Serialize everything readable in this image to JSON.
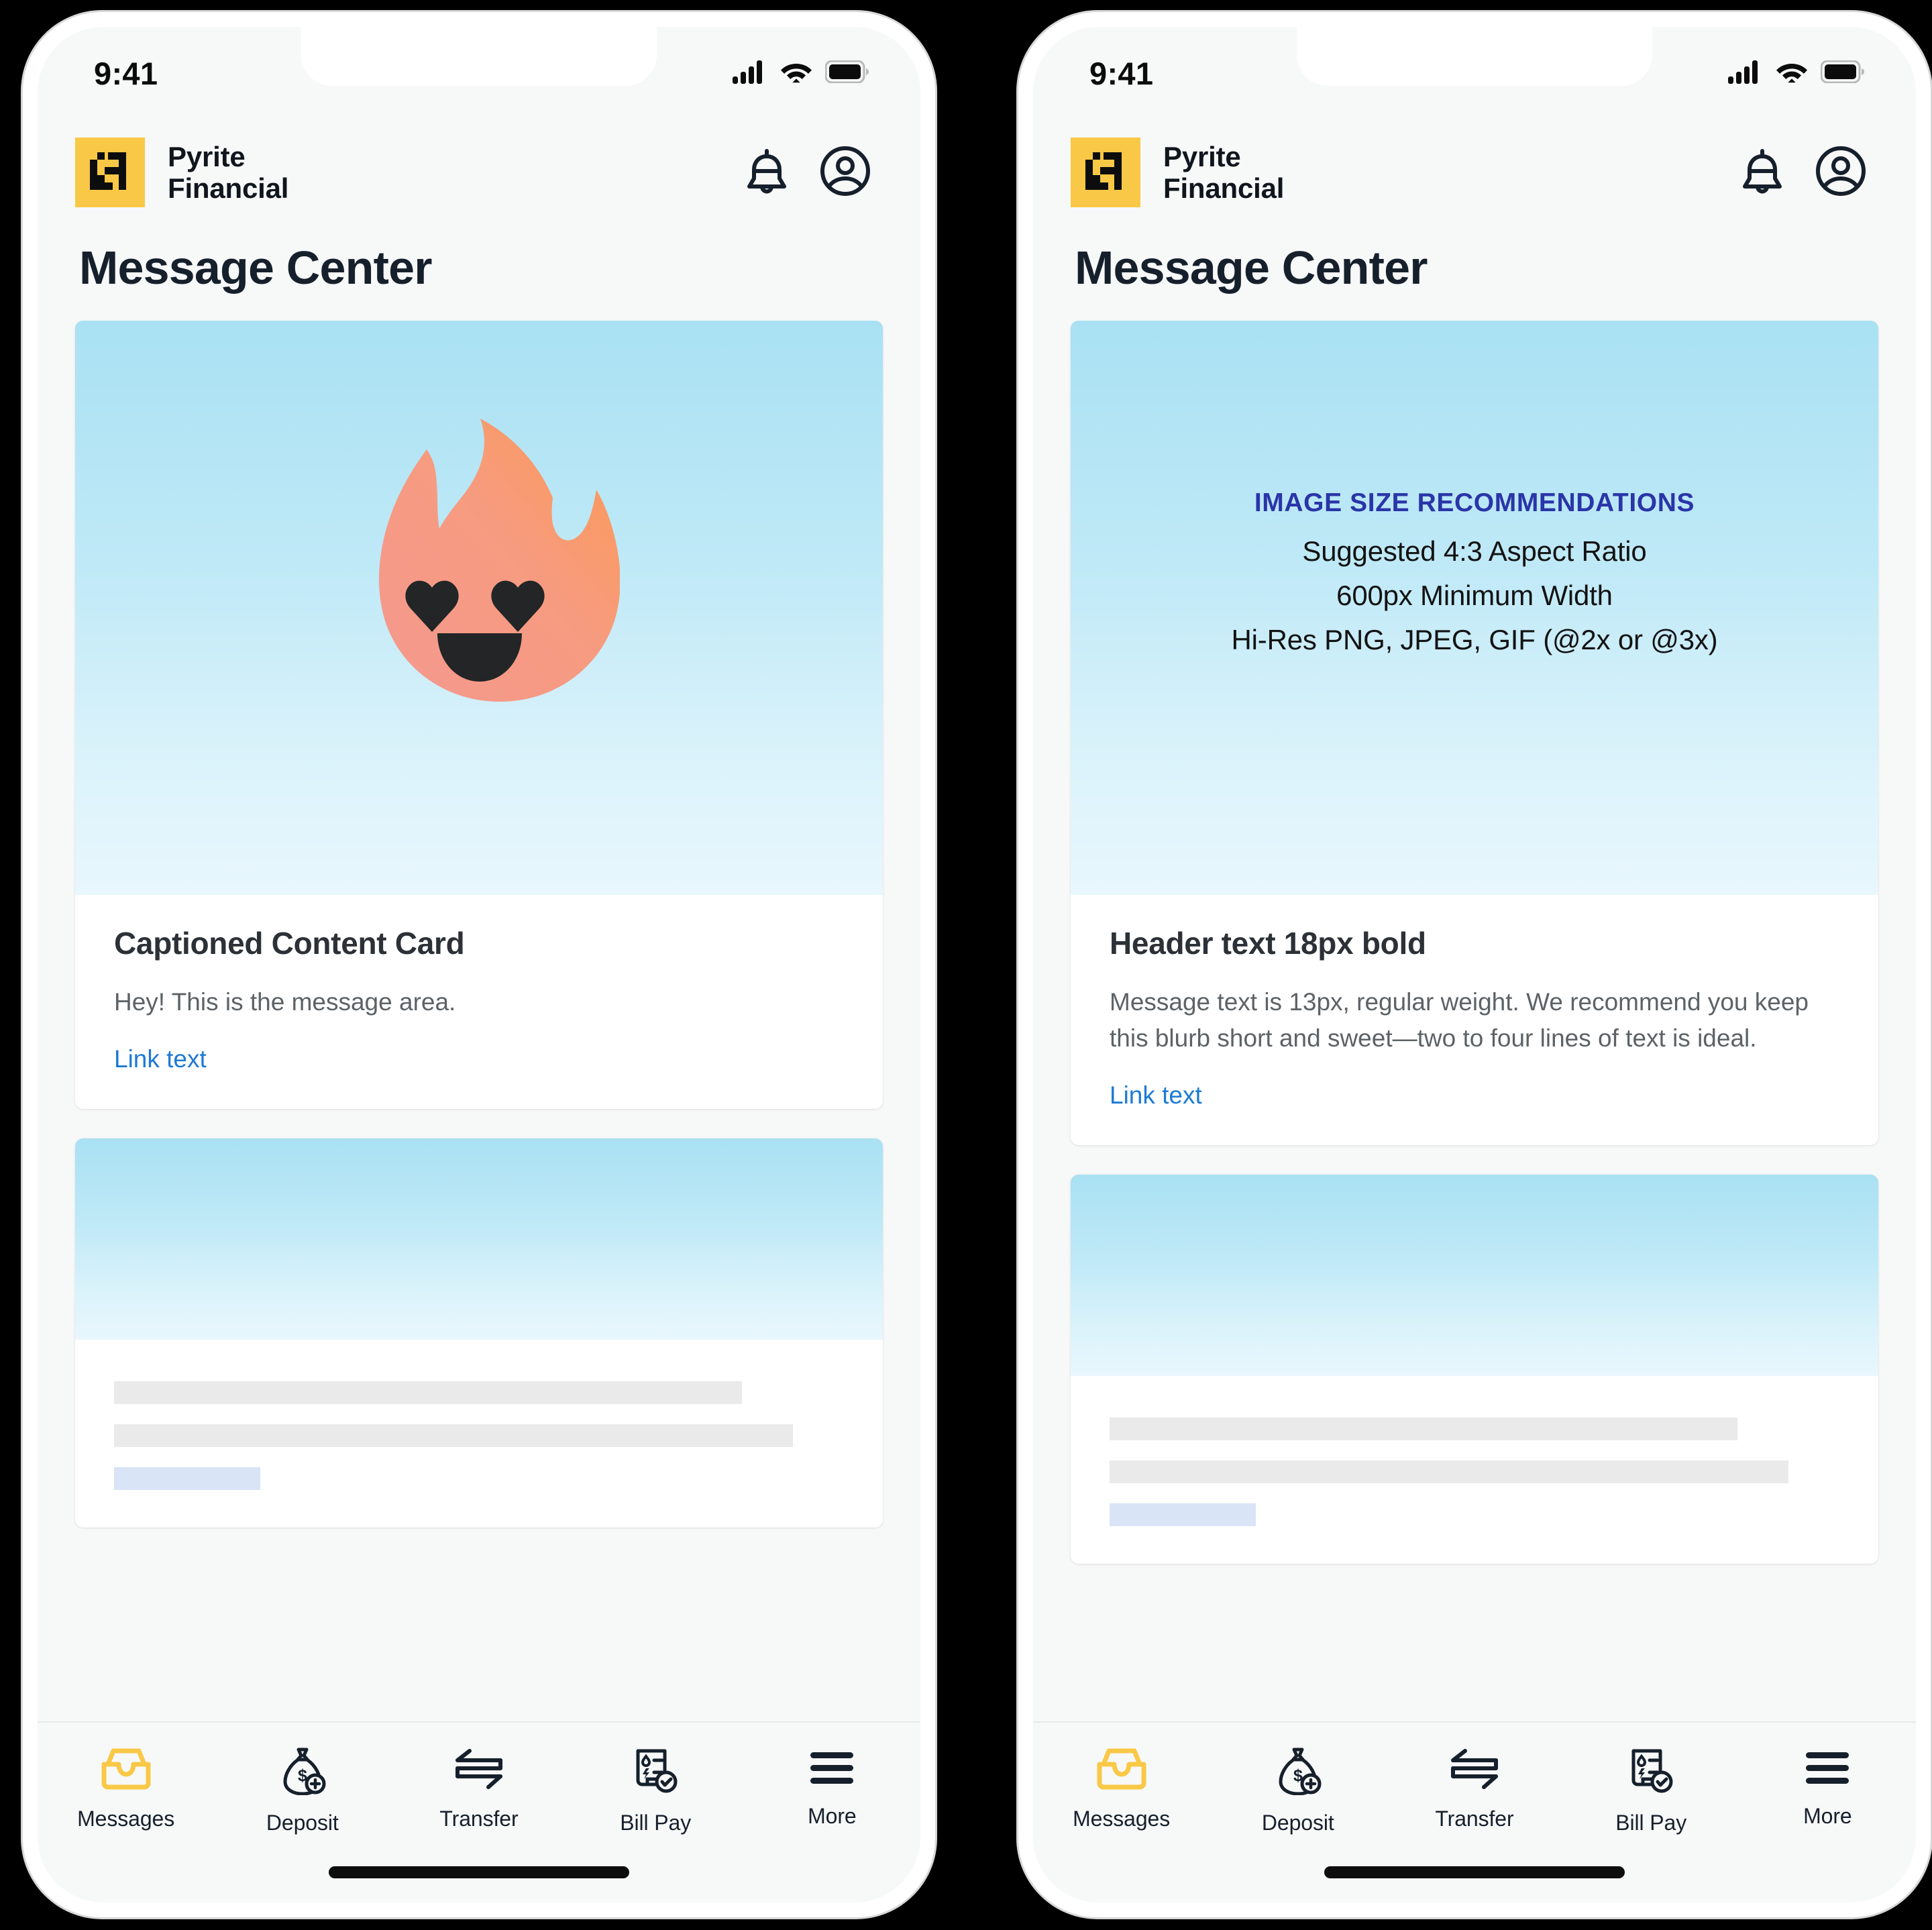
{
  "phones": [
    {
      "id": "left",
      "status": {
        "time": "9:41",
        "signal": "cellular-signal-icon",
        "wifi": "wifi-icon",
        "battery": "battery-full-icon"
      },
      "header": {
        "logo": "pyrite-logo-mark",
        "brand_name": "Pyrite\nFinancial",
        "notifications_icon": "bell-icon",
        "account_icon": "account-circle-icon"
      },
      "page_title": "Message Center",
      "cards": [
        {
          "type": "captioned-content",
          "hero": "flame-mascot-heart-eyes-illustration",
          "header": "Captioned Content Card",
          "message": "Hey! This is the message area.",
          "link": "Link text"
        },
        {
          "type": "skeleton"
        }
      ],
      "tabs": [
        {
          "label": "Messages",
          "icon": "inbox-tray-icon",
          "active": true
        },
        {
          "label": "Deposit",
          "icon": "money-bag-icon",
          "active": false
        },
        {
          "label": "Transfer",
          "icon": "transfer-arrows-icon",
          "active": false
        },
        {
          "label": "Bill Pay",
          "icon": "bill-invoice-check-icon",
          "active": false
        },
        {
          "label": "More",
          "icon": "hamburger-menu-icon",
          "active": false
        }
      ]
    },
    {
      "id": "right",
      "status": {
        "time": "9:41",
        "signal": "cellular-signal-icon",
        "wifi": "wifi-icon",
        "battery": "battery-full-icon"
      },
      "header": {
        "logo": "pyrite-logo-mark",
        "brand_name": "Pyrite\nFinancial",
        "notifications_icon": "bell-icon",
        "account_icon": "account-circle-icon"
      },
      "page_title": "Message Center",
      "cards": [
        {
          "type": "spec-content",
          "spec_title": "IMAGE SIZE RECOMMENDATIONS",
          "spec_lines": [
            "Suggested 4:3 Aspect Ratio",
            "600px Minimum Width",
            "Hi-Res PNG, JPEG, GIF (@2x or @3x)"
          ],
          "header": "Header text 18px bold",
          "message": "Message text is 13px, regular weight. We recommend you keep this blurb short and sweet—two to four lines of text is ideal.",
          "link": "Link text"
        },
        {
          "type": "skeleton"
        }
      ],
      "tabs": [
        {
          "label": "Messages",
          "icon": "inbox-tray-icon",
          "active": true
        },
        {
          "label": "Deposit",
          "icon": "money-bag-icon",
          "active": false
        },
        {
          "label": "Transfer",
          "icon": "transfer-arrows-icon",
          "active": false
        },
        {
          "label": "Bill Pay",
          "icon": "bill-invoice-check-icon",
          "active": false
        },
        {
          "label": "More",
          "icon": "hamburger-menu-icon",
          "active": false
        }
      ]
    }
  ],
  "colors": {
    "brand_yellow": "#f9c846",
    "link_blue": "#1d7ad4",
    "spec_title_blue": "#2a35a8",
    "title_navy": "#16202c",
    "hero_gradient_top": "#a9e1f3",
    "hero_gradient_bottom": "#e8f7fd",
    "skeleton_gray": "#eaeaea",
    "skeleton_link_blue": "#d9e4f7",
    "flame_top": "#f79b72",
    "flame_bottom": "#f49a8c",
    "screen_bg": "#f7f8f8"
  }
}
